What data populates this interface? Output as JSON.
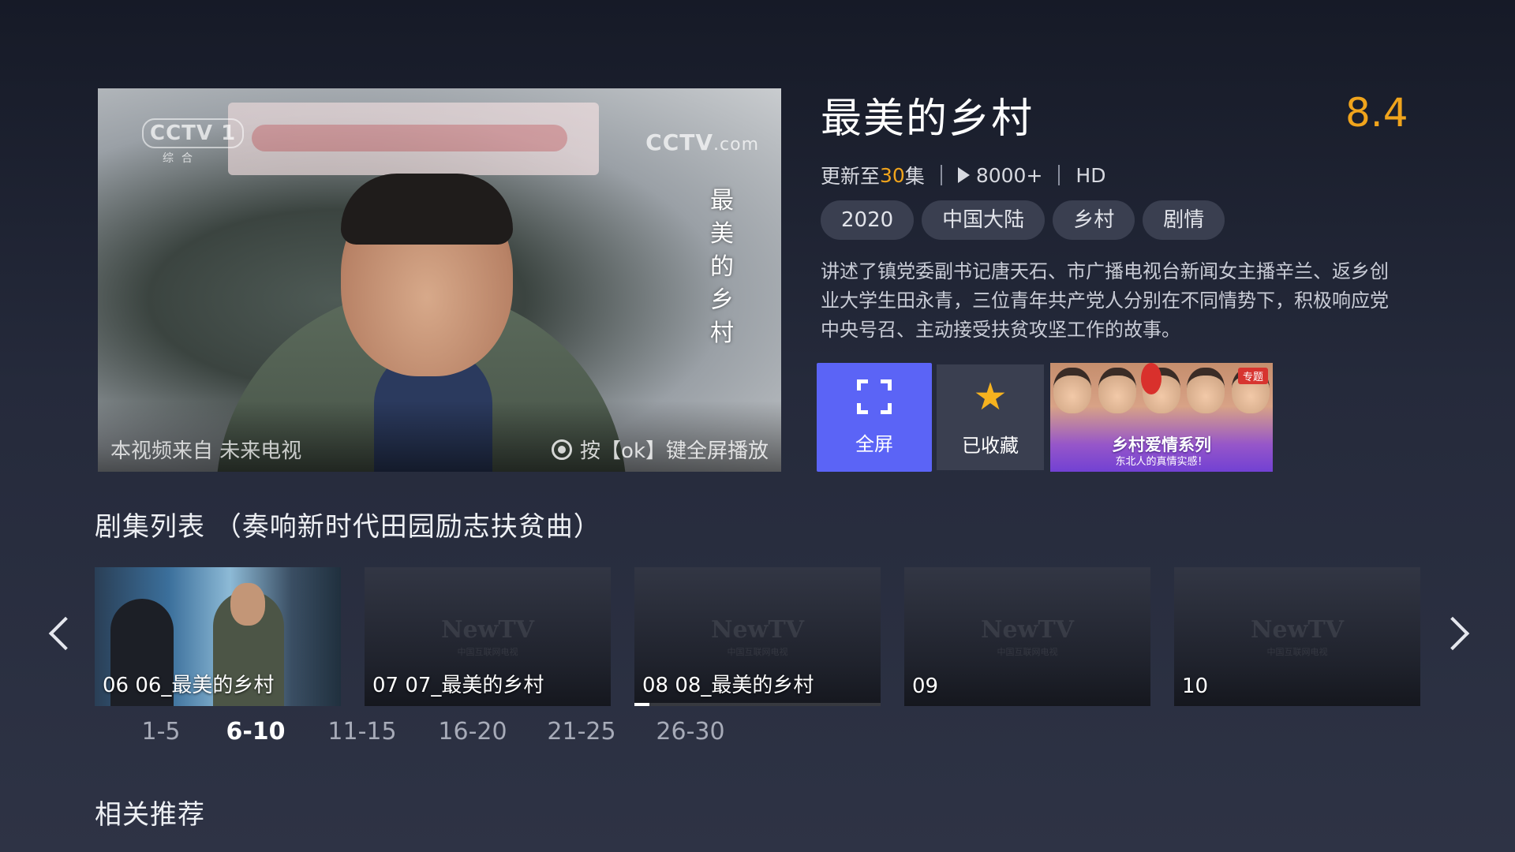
{
  "player": {
    "channel_logo": "CCTV 1",
    "channel_sub": "综合",
    "site_logo": "CCTV",
    "site_logo_suffix": ".com",
    "vertical_title": [
      "最",
      "美",
      "的",
      "乡",
      "村"
    ],
    "source_text": "本视频来自 未来电视",
    "play_hint": "按【ok】键全屏播放",
    "hint_icon": "ok-button-icon"
  },
  "info": {
    "title": "最美的乡村",
    "rating": "8.4",
    "update_prefix": "更新至",
    "update_count": "30",
    "update_suffix": "集",
    "play_count": "8000+",
    "quality": "HD",
    "tags": [
      "2020",
      "中国大陆",
      "乡村",
      "剧情"
    ],
    "synopsis": "讲述了镇党委副书记唐天石、市广播电视台新闻女主播辛兰、返乡创业大学生田永青，三位青年共产党人分别在不同情势下，积极响应党中央号召、主动接受扶贫攻坚工作的故事。",
    "accent_color": "#f0a41c"
  },
  "actions": {
    "fullscreen_label": "全屏",
    "fullscreen_icon": "expand-icon",
    "favorite_label": "已收藏",
    "favorite_icon": "star-icon",
    "button_color": "#5b64f6"
  },
  "promo": {
    "badge": "专题",
    "title": "乡村爱情系列",
    "subtitle": "东北人的真情实感！"
  },
  "episodes": {
    "section_title": "剧集列表 （奏响新时代田园励志扶贫曲）",
    "placeholder_brand": "NewTV",
    "placeholder_sub": "中国互联网电视",
    "items": [
      {
        "label": "06 06_最美的乡村",
        "has_thumb": true
      },
      {
        "label": "07 07_最美的乡村",
        "has_thumb": false
      },
      {
        "label": "08 08_最美的乡村",
        "has_thumb": false,
        "progress": 0.06
      },
      {
        "label": "09",
        "has_thumb": false
      },
      {
        "label": "10",
        "has_thumb": false
      }
    ],
    "ranges": [
      "1-5",
      "6-10",
      "11-15",
      "16-20",
      "21-25",
      "26-30"
    ],
    "active_range": "6-10"
  },
  "recommend": {
    "section_title": "相关推荐"
  }
}
